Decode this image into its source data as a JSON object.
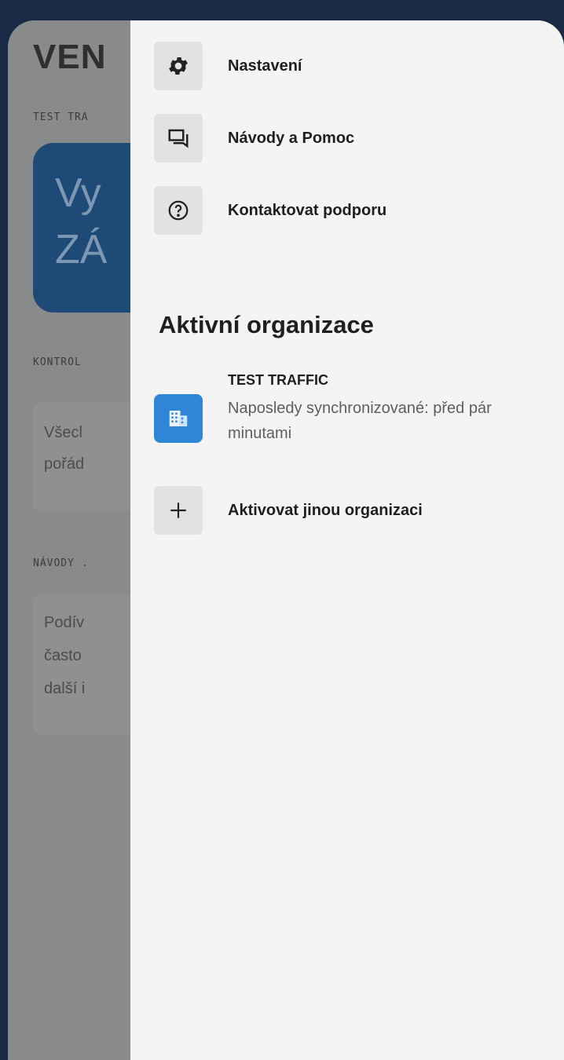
{
  "background": {
    "logo": "VEN",
    "org_label": "TEST TRA",
    "hero_line1": "Vy",
    "hero_line2": "ZÁ",
    "control_label": "KONTROL",
    "control_line1": "Všecl",
    "control_line2": "pořád",
    "guides_label": "NÁVODY .",
    "guides_line1": "Podív",
    "guides_line2": "často",
    "guides_line3": "další i"
  },
  "drawer": {
    "menu": [
      {
        "label": "Nastavení",
        "icon": "gear-icon"
      },
      {
        "label": "Návody a Pomoc",
        "icon": "chat-icon"
      },
      {
        "label": "Kontaktovat podporu",
        "icon": "help-circle-icon"
      }
    ],
    "section_title": "Aktivní organizace",
    "active_org": {
      "name": "TEST TRAFFIC",
      "sync_status": "Naposledy synchronizované: před pár minutami",
      "icon": "building-icon",
      "icon_color": "#2f86d6"
    },
    "activate_other": {
      "label": "Aktivovat jinou organizaci",
      "icon": "plus-icon"
    }
  },
  "colors": {
    "frame": "#1a2b45",
    "hero": "#1e4a78",
    "drawer_bg": "#f4f4f4"
  }
}
